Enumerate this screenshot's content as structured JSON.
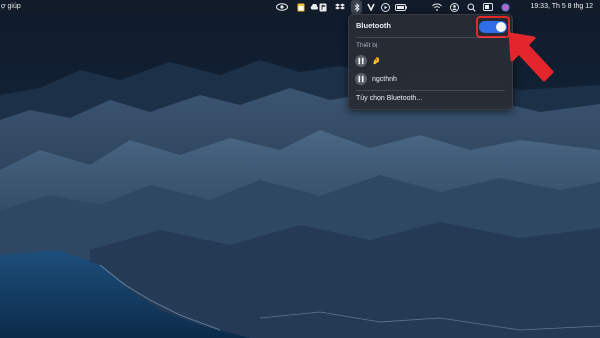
{
  "menubar": {
    "left_text": "ợ giúp",
    "clock": "19:33, Th 5 8 thg 12",
    "icons": [
      "control-center-icon",
      "notes-app-icon",
      "cloud-icon",
      "flag-icon",
      "dropbox-icon",
      "bluetooth-icon",
      "v-app-icon",
      "play-icon",
      "battery-icon",
      "wifi-icon",
      "user-icon",
      "search-icon",
      "screen-icon",
      "siri-icon"
    ]
  },
  "bluetooth_panel": {
    "title": "Bluetooth",
    "toggle_on": true,
    "devices_label": "Thiết bị",
    "devices": [
      {
        "name": "🤌",
        "icon": "airpods-icon"
      },
      {
        "name": "ngcthnh",
        "icon": "airpods-icon"
      }
    ],
    "options_label": "Tùy chọn Bluetooth..."
  },
  "colors": {
    "accent": "#2f6ee8",
    "highlight": "#e3262c"
  }
}
